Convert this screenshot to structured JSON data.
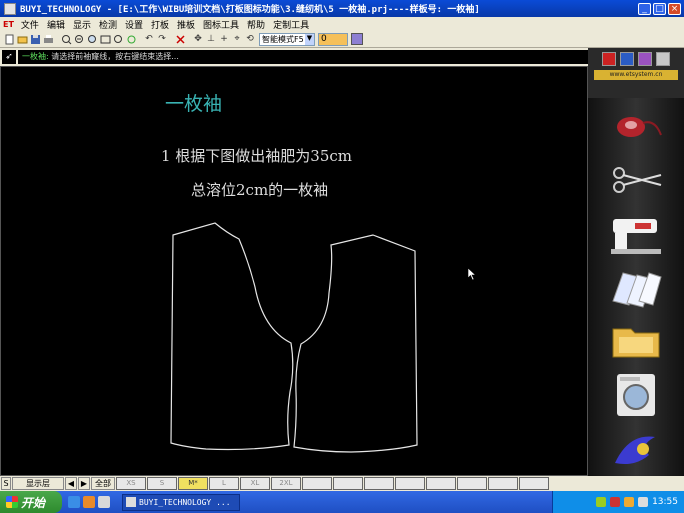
{
  "window": {
    "title": "BUYI_TECHNOLOGY - [E:\\工作\\WIBU培训文档\\打板图标功能\\3.缝纫机\\5 一枚袖.prj----样板号: 一枚袖]",
    "min_label": "_",
    "max_label": "□",
    "close_label": "×"
  },
  "menubar": {
    "logo": "ET",
    "items": [
      "文件",
      "编辑",
      "显示",
      "检测",
      "设置",
      "打板",
      "推板",
      "图标工具",
      "帮助",
      "定制工具"
    ]
  },
  "toolbar": {
    "mode_select": "智能模式F5",
    "number_value": "0"
  },
  "status": {
    "tag": "一枚袖:",
    "message": "请选择前袖窿线，按右键结束选择..."
  },
  "canvas": {
    "heading": "一枚袖",
    "instruction_1": "1  根据下图做出袖肥为35cm",
    "instruction_2": "总溶位2cm的一枚袖"
  },
  "right_panel": {
    "url": "www.etsystem.cn",
    "tools": [
      "bobbin-icon",
      "scissors-icon",
      "sewing-machine-icon",
      "paper-pattern-icon",
      "folder-icon",
      "washing-machine-icon",
      "logo-swirl-icon"
    ]
  },
  "bottombar": {
    "s_label": "S",
    "layer_button": "显示层",
    "all_button": "全部",
    "sizes": [
      "XS",
      "S",
      "M*",
      "L",
      "XL",
      "2XL",
      "",
      "",
      "",
      "",
      "",
      "",
      "",
      ""
    ]
  },
  "taskbar": {
    "start_label": "开始",
    "task_label": "BUYI_TECHNOLOGY ...",
    "clock": "13:55"
  },
  "colors": {
    "accent_heading": "#39b3b3",
    "canvas_background": "#000000",
    "active_size": "#f0e060"
  }
}
